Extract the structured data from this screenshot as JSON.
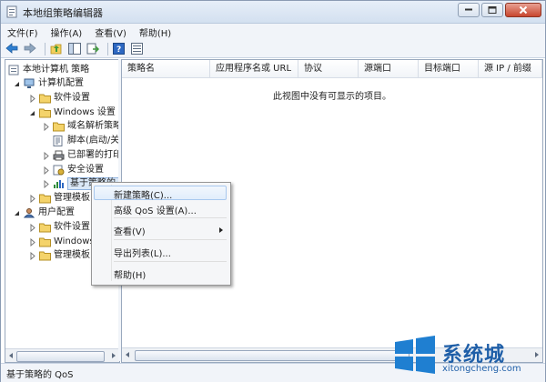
{
  "window": {
    "title": "本地组策略编辑器"
  },
  "menubar": {
    "items": [
      "文件(F)",
      "操作(A)",
      "查看(V)",
      "帮助(H)"
    ]
  },
  "tree": {
    "root": "本地计算机 策略",
    "computer_config": "计算机配置",
    "software_settings": "软件设置",
    "windows_settings": "Windows 设置",
    "dns_policy": "域名解析策略",
    "scripts": "脚本(启动/关",
    "deployed_printers": "已部署的打印",
    "security_settings": "安全设置",
    "qos_policy": "基于策略的 Q",
    "admin_templates": "管理模板",
    "user_config": "用户配置",
    "user_software_settings": "软件设置",
    "user_windows_settings": "Windows",
    "user_admin_templates": "管理模板"
  },
  "list": {
    "columns": [
      "策略名",
      "应用程序名或 URL",
      "协议",
      "源端口",
      "目标端口",
      "源 IP / 前缀"
    ],
    "empty_message": "此视图中没有可显示的项目。"
  },
  "context_menu": {
    "items": [
      "新建策略(C)...",
      "高级 QoS 设置(A)...",
      "查看(V)",
      "导出列表(L)...",
      "帮助(H)"
    ]
  },
  "status": {
    "text": "基于策略的 QoS"
  },
  "watermark": {
    "text": "系统城",
    "url": "xitongcheng.com"
  },
  "colors": {
    "accent": "#1f5fa8",
    "title_gradient_top": "#e6eef8",
    "close_red": "#c8462e"
  }
}
